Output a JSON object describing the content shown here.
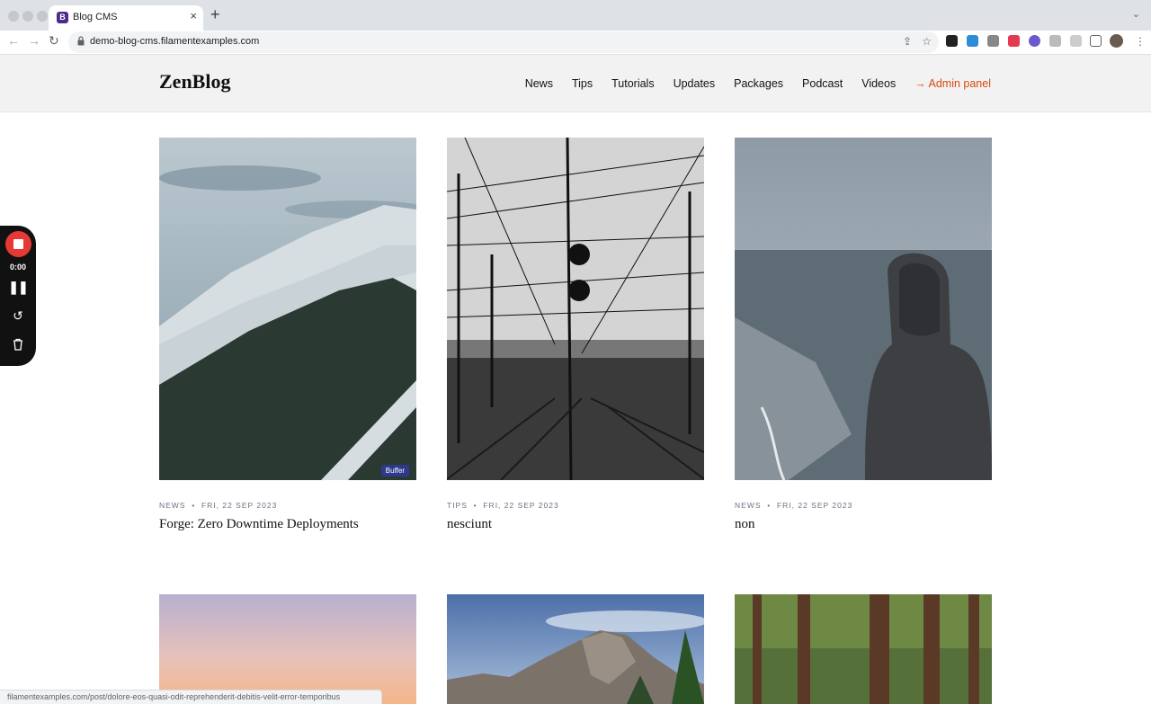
{
  "browser": {
    "tab_title": "Blog CMS",
    "tab_favicon_letter": "B",
    "new_tab": "+",
    "close_tab": "×",
    "url": "demo-blog-cms.filamentexamples.com",
    "status_url": "filamentexamples.com/post/dolore-eos-quasi-odit-reprehenderit-debitis-velit-error-temporibus"
  },
  "site": {
    "logo": "ZenBlog",
    "nav": [
      "News",
      "Tips",
      "Tutorials",
      "Updates",
      "Packages",
      "Podcast",
      "Videos"
    ],
    "admin_link": "→ Admin panel"
  },
  "recorder": {
    "time": "0:00"
  },
  "posts": [
    {
      "category": "News",
      "date": "Fri, 22 Sep 2023",
      "title": "Forge: Zero Downtime Deployments",
      "image": "snowy-mountain",
      "badge": "Buffer"
    },
    {
      "category": "Tips",
      "date": "Fri, 22 Sep 2023",
      "title": "nesciunt",
      "image": "railway-wires"
    },
    {
      "category": "News",
      "date": "Fri, 22 Sep 2023",
      "title": "non",
      "image": "hooded-person-sea"
    },
    {
      "image": "sunset-sky"
    },
    {
      "image": "rock-cliffs"
    },
    {
      "image": "forest-trees"
    }
  ],
  "colors": {
    "accent": "#d9480f",
    "header_bg": "#f2f2f3",
    "record": "#e53935"
  }
}
